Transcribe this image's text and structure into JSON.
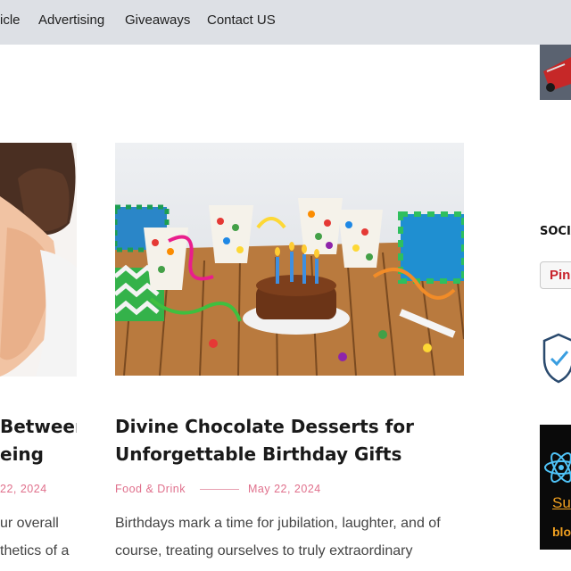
{
  "nav": {
    "items": [
      "icle",
      "Advertising",
      "Giveaways",
      "Contact US"
    ]
  },
  "left_post": {
    "title_lines": [
      "Between",
      "eing"
    ],
    "date": "22, 2024",
    "excerpt_lines": [
      "ur overall",
      "thetics of a"
    ]
  },
  "main_post": {
    "title_lines": [
      "Divine Chocolate Desserts for",
      "Unforgettable Birthday Gifts"
    ],
    "category": "Food & Drink",
    "date": "May 22, 2024",
    "excerpt_lines": [
      "Birthdays mark a time for jubilation, laughter, and of",
      "course, treating ourselves to truly extraordinary"
    ]
  },
  "sidebar": {
    "social_heading": "SOCIA",
    "pinterest_label": "Pin",
    "banner_line1": "Su",
    "banner_line2": "blo"
  },
  "colors": {
    "nav_bg": "#dde0e5",
    "meta_pink": "#e0708c",
    "pinterest_red": "#c8232c",
    "banner_orange": "#f0a020"
  },
  "icons": [
    "shield-check-icon",
    "atom-icon"
  ]
}
